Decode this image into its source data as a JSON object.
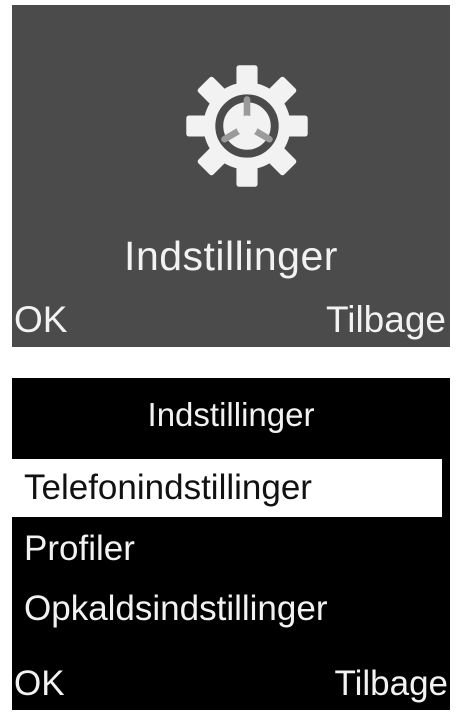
{
  "screen1": {
    "icon": "gear-icon",
    "title": "Indstillinger",
    "softkey_left": "OK",
    "softkey_right": "Tilbage"
  },
  "screen2": {
    "title": "Indstillinger",
    "menu": [
      {
        "label": "Telefonindstillinger",
        "selected": true
      },
      {
        "label": "Profiler",
        "selected": false
      },
      {
        "label": "Opkaldsindstillinger",
        "selected": false
      }
    ],
    "softkey_left": "OK",
    "softkey_right": "Tilbage"
  },
  "colors": {
    "screen1_bg": "#4b4b4b",
    "screen2_bg": "#000000",
    "text": "#f2f2f2",
    "highlight": "#ffffff"
  }
}
